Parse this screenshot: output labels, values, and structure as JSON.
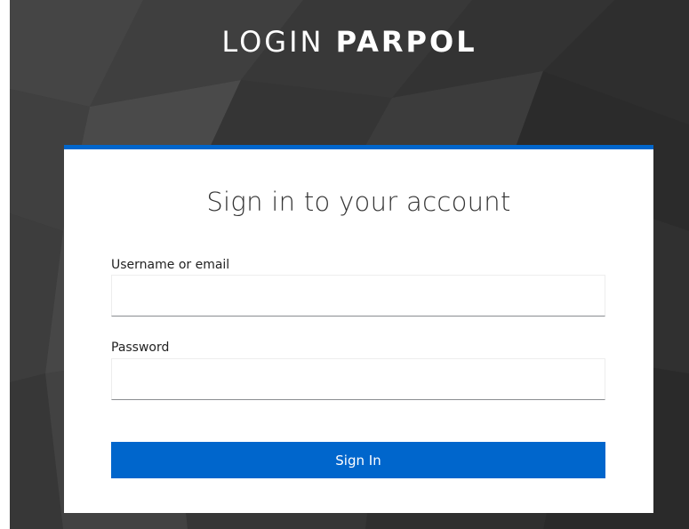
{
  "header": {
    "title_light": "LOGIN",
    "title_bold": "PARPOL"
  },
  "login_card": {
    "title": "Sign in to your account",
    "username": {
      "label": "Username or email",
      "value": "",
      "placeholder": ""
    },
    "password": {
      "label": "Password",
      "value": "",
      "placeholder": ""
    },
    "submit_label": "Sign In"
  },
  "colors": {
    "accent": "#0066cc",
    "background": "#3a3a3a",
    "card": "#ffffff"
  }
}
